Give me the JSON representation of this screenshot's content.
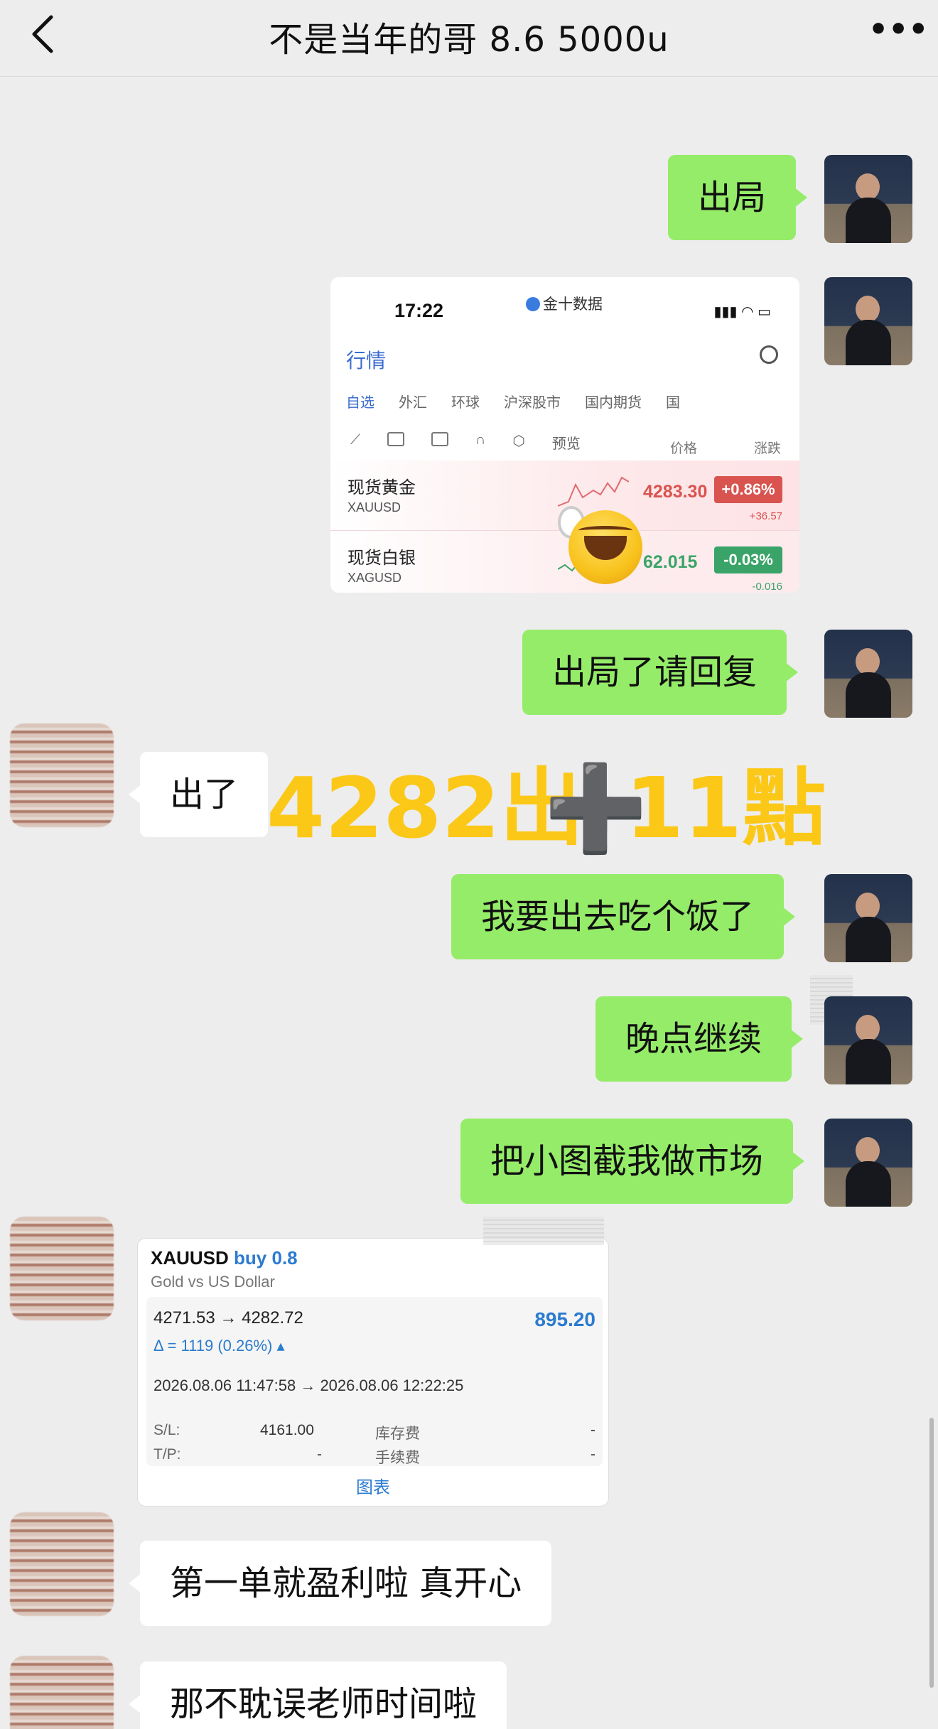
{
  "header": {
    "title": "不是当年的哥 8.6 5000u",
    "back_icon": "chevron-left-icon",
    "more_label": "•••"
  },
  "messages": {
    "m1": "出局",
    "m3": "出局了请回复",
    "m4": "出了",
    "m5": "我要出去吃个饭了",
    "m6": "晚点继续",
    "m7": "把小图截我做市场",
    "m9": "第一单就盈利啦 真开心",
    "m10": "那不耽误老师时间啦"
  },
  "overlay": {
    "price": "4282出",
    "plus": "➕",
    "points": "11點"
  },
  "quote_screenshot": {
    "time": "17:22",
    "app": "金十数据",
    "section": "行情",
    "tabs": [
      "自选",
      "外汇",
      "环球",
      "沪深股市",
      "国内期货",
      "国"
    ],
    "preview_label": "预览",
    "col_price": "价格",
    "col_change": "涨跌",
    "rows": [
      {
        "name": "现货黄金",
        "code": "XAUUSD",
        "price": "4283.30",
        "pct": "+0.86%",
        "chg": "+36.57"
      },
      {
        "name": "现货白银",
        "code": "XAGUSD",
        "price": "62.015",
        "pct": "-0.03%",
        "chg": "-0.016"
      }
    ]
  },
  "trade_card": {
    "symbol": "XAUUSD",
    "side": "buy 0.8",
    "desc": "Gold vs US Dollar",
    "prices": "4271.53 → 4282.72",
    "profit": "895.20",
    "delta": "Δ = 1119 (0.26%) ▴",
    "dates": "2026.08.06 11:47:58 → 2026.08.06 12:22:25",
    "sl_label": "S/L:",
    "sl_value": "4161.00",
    "tp_label": "T/P:",
    "tp_value": "-",
    "storage_label": "库存费",
    "storage_value": "-",
    "fee_label": "手续费",
    "fee_value": "-",
    "chart_link": "图表"
  },
  "colors": {
    "bg": "#ededed",
    "my_bubble": "#95ec69",
    "their_bubble": "#ffffff",
    "overlay_gold": "#fbc818",
    "up_red": "#d9534f",
    "down_green": "#3aa468"
  }
}
